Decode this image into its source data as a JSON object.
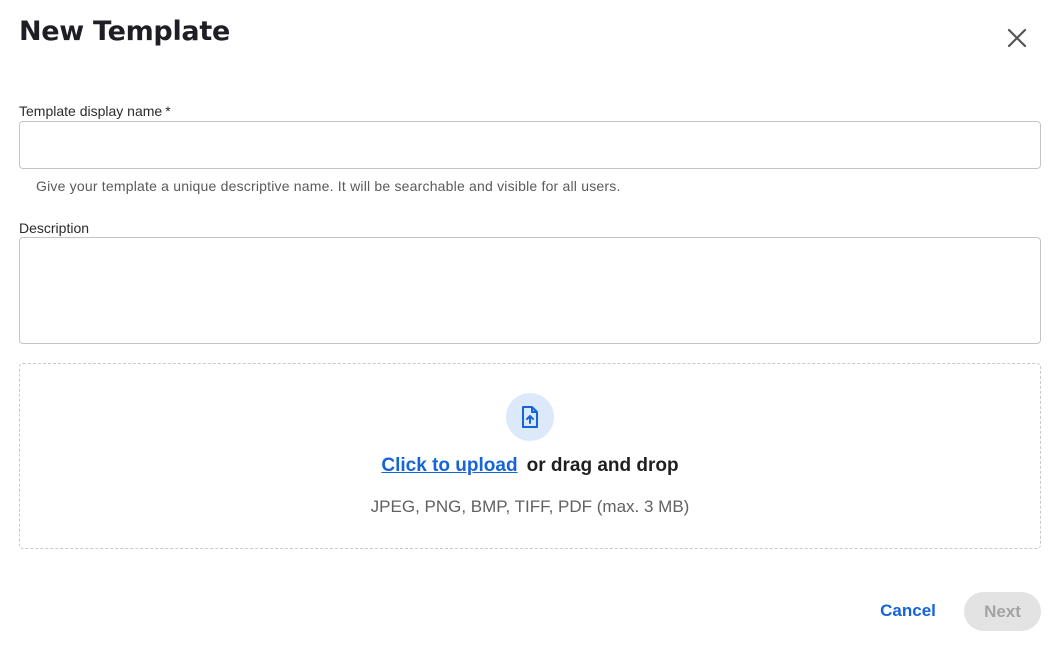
{
  "dialog": {
    "title": "New Template",
    "close_icon": "close-icon"
  },
  "form": {
    "name_label": "Template display name",
    "required_marker": "*",
    "name_value": "",
    "name_helper": "Give your template a unique descriptive name. It will be searchable and visible for all users.",
    "description_label": "Description",
    "description_value": ""
  },
  "upload": {
    "icon": "file-upload-icon",
    "link_text": "Click to upload",
    "drag_text": "or drag and drop",
    "formats": "JPEG, PNG, BMP, TIFF, PDF (max. 3 MB)"
  },
  "footer": {
    "cancel_label": "Cancel",
    "next_label": "Next"
  },
  "colors": {
    "accent": "#1565d8",
    "icon_bg": "#dce9fb",
    "disabled_bg": "#e3e3e3",
    "disabled_text": "#a3a3a3"
  }
}
